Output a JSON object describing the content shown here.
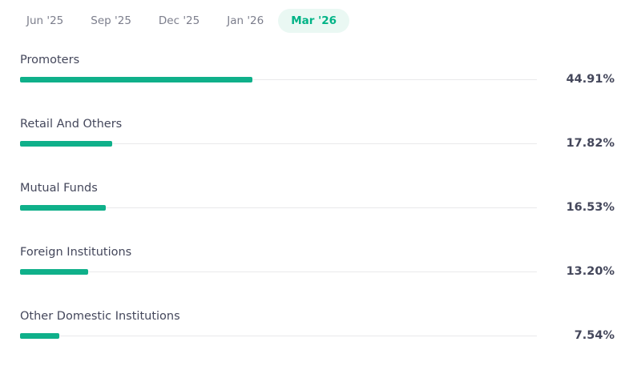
{
  "tabs": [
    {
      "label": "Jun '25",
      "active": false
    },
    {
      "label": "Sep '25",
      "active": false
    },
    {
      "label": "Dec '25",
      "active": false
    },
    {
      "label": "Jan '26",
      "active": false
    },
    {
      "label": "Mar '26",
      "active": true
    }
  ],
  "holdings": [
    {
      "label": "Promoters",
      "value": "44.91%",
      "percent": 44.91
    },
    {
      "label": "Retail And Others",
      "value": "17.82%",
      "percent": 17.82
    },
    {
      "label": "Mutual Funds",
      "value": "16.53%",
      "percent": 16.53
    },
    {
      "label": "Foreign Institutions",
      "value": "13.20%",
      "percent": 13.2
    },
    {
      "label": "Other Domestic Institutions",
      "value": "7.54%",
      "percent": 7.54
    }
  ],
  "colors": {
    "accent": "#00b386",
    "bar": "#0fb08a",
    "active_tab_bg": "#eaf8f3",
    "track": "#e9e9eb",
    "text": "#44475b",
    "muted": "#7c7e8c"
  }
}
